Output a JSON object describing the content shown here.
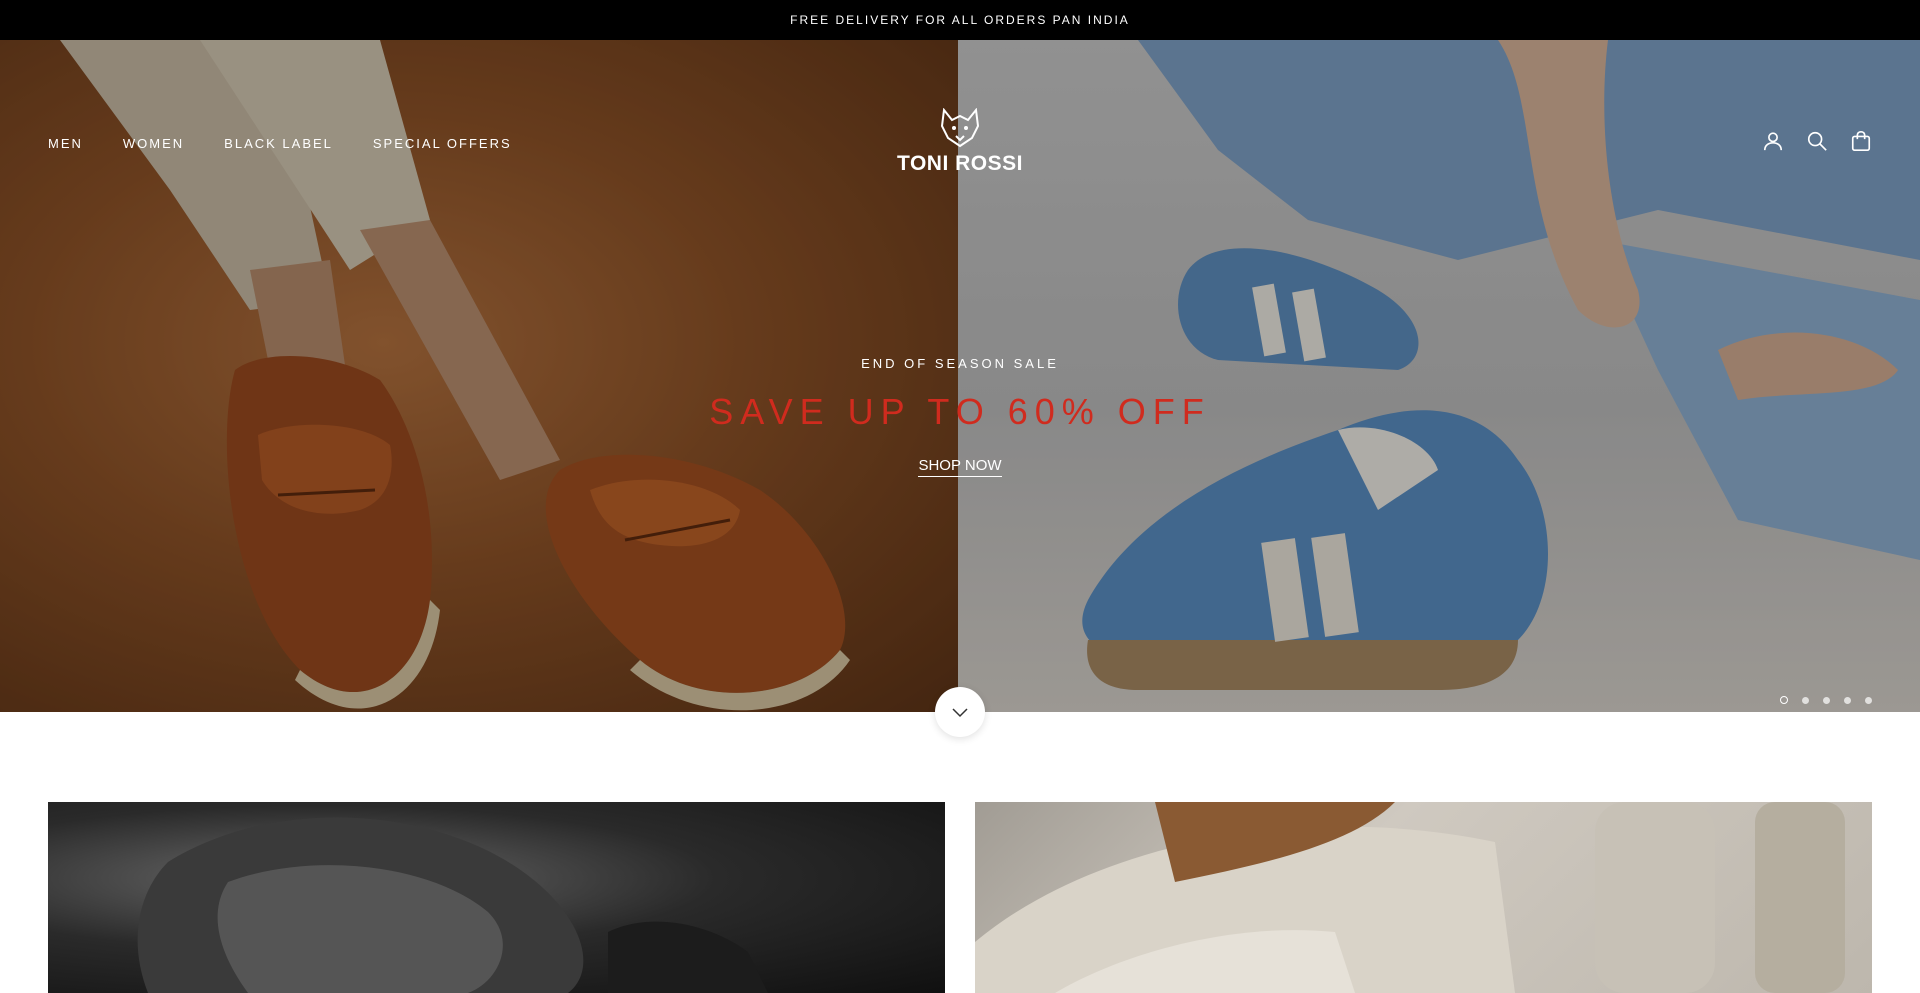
{
  "announcement": {
    "text": "FREE DELIVERY FOR ALL ORDERS PAN INDIA"
  },
  "nav": {
    "items": [
      {
        "label": "MEN"
      },
      {
        "label": "WOMEN"
      },
      {
        "label": "BLACK LABEL"
      },
      {
        "label": "SPECIAL OFFERS"
      }
    ]
  },
  "logo": {
    "text": "TONI ROSSI",
    "icon": "wolf-head-icon"
  },
  "header_icons": [
    "account-icon",
    "search-icon",
    "shopping-bag-icon"
  ],
  "hero": {
    "kicker": "END OF SEASON SALE",
    "headline": "SAVE UP TO 60% OFF",
    "cta": "SHOP NOW",
    "slides_count": 5,
    "active_slide": 1
  },
  "colors": {
    "announcement_bg": "#000000",
    "headline": "#d02b1e",
    "text_light": "#ffffff"
  }
}
